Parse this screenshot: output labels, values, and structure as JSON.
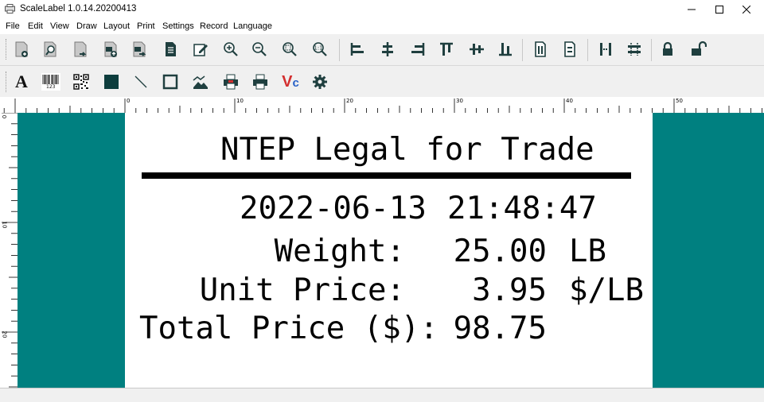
{
  "window": {
    "title": "ScaleLabel 1.0.14.20200413",
    "minimize": "—",
    "maximize": "☐",
    "close": "✕"
  },
  "menu": [
    "File",
    "Edit",
    "View",
    "Draw",
    "Layout",
    "Print",
    "Settings",
    "Record",
    "Language"
  ],
  "toolbar1": [
    "new-file",
    "open-file",
    "save-file",
    "upload-file",
    "download-file",
    "document",
    "edit",
    "zoom-in",
    "zoom-out",
    "zoom-fit",
    "zoom-reset",
    "align-left",
    "align-center",
    "align-right",
    "align-top",
    "align-middle",
    "align-bottom",
    "distribute-horizontal",
    "distribute-vertical",
    "spacing-horizontal",
    "spacing-vertical",
    "lock",
    "unlock"
  ],
  "toolbar2": [
    "text",
    "barcode",
    "qrcode",
    "filled-rectangle",
    "line",
    "rectangle",
    "image",
    "print-preview",
    "print",
    "variable",
    "settings"
  ],
  "toolbar2_text": {
    "text_glyph": "A",
    "barcode_digits": "123",
    "variable_glyph": "V",
    "variable_sub": "c"
  },
  "ruler": {
    "top": [
      "0",
      "10",
      "20",
      "30",
      "40",
      "50"
    ],
    "left": [
      "0",
      "10",
      "20"
    ]
  },
  "label": {
    "title": "NTEP Legal for Trade",
    "date": "2022-06-13",
    "time": "21:48:47",
    "weight_label": "Weight:",
    "weight_value": "25.00",
    "weight_unit": "LB",
    "unit_price_label": "Unit Price:",
    "unit_price_value": "3.95",
    "unit_price_unit": "$/LB",
    "total_label": "Total Price ($):",
    "total_value": "98.75"
  },
  "colors": {
    "canvas": "#008080",
    "label": "#ffffff",
    "icon_dark": "#1f4e4e",
    "variable_red": "#d32f2f",
    "variable_blue": "#2962c8"
  }
}
